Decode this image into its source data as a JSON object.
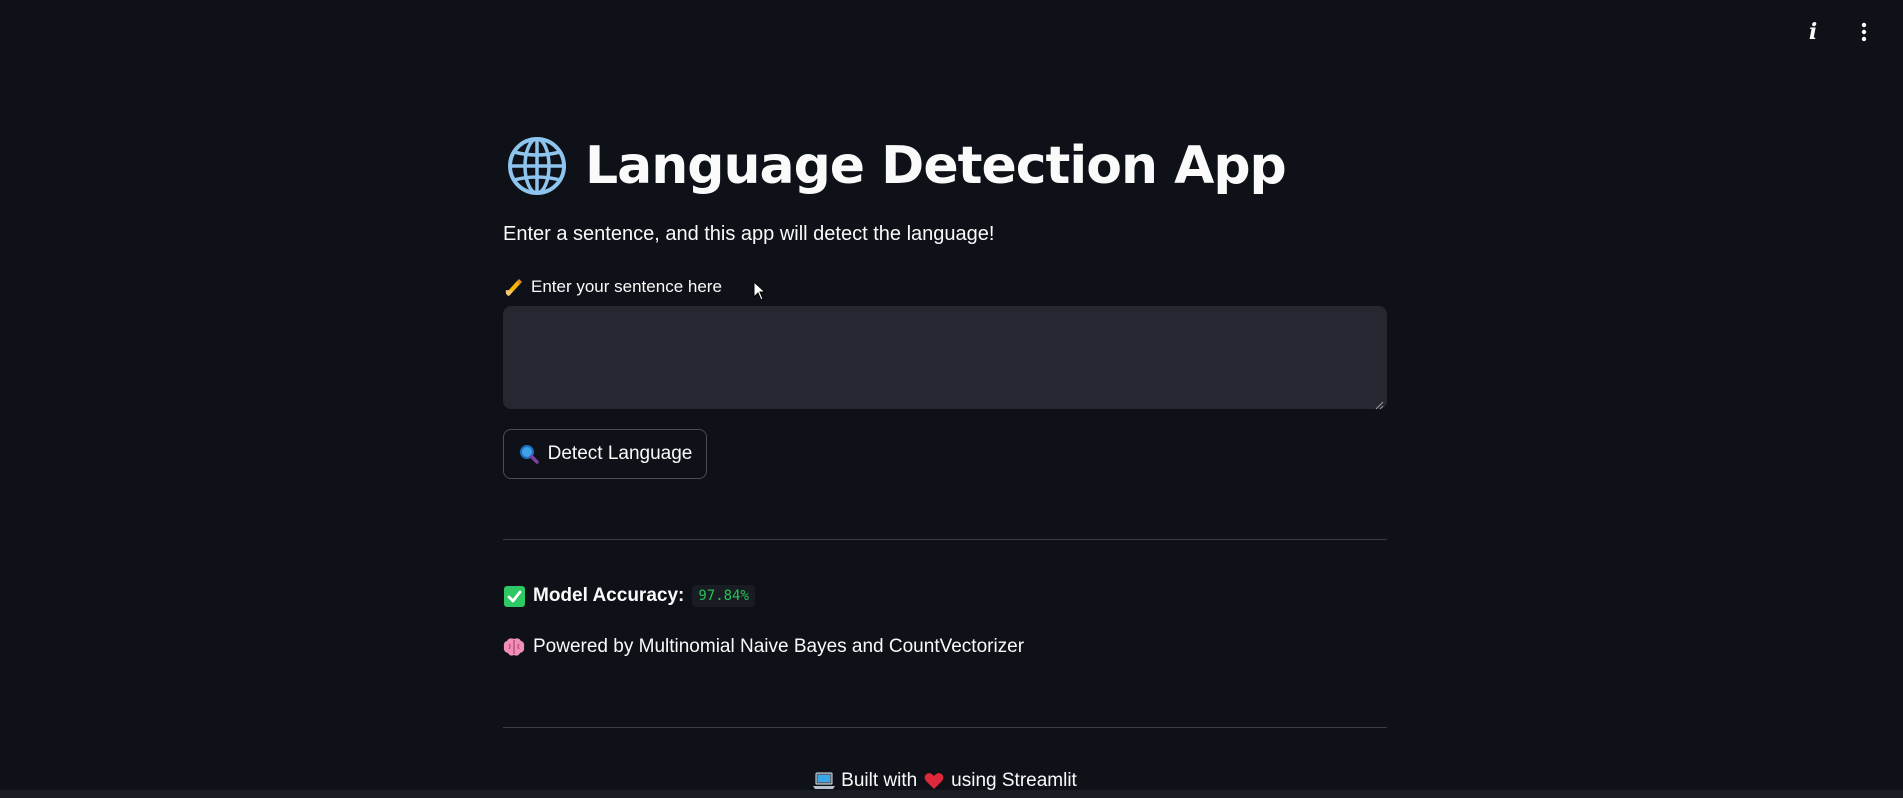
{
  "header": {
    "info_icon": "i",
    "menu_icon": "kebab-menu-icon"
  },
  "app": {
    "title": "Language Detection App",
    "title_icon": "globe-icon",
    "subtitle": "Enter a sentence, and this app will detect the language!",
    "input": {
      "label": "Enter your sentence here",
      "label_icon": "writing-hand-icon",
      "value": "",
      "placeholder": ""
    },
    "detect_button": {
      "label": "Detect Language",
      "icon": "magnifier-icon"
    },
    "accuracy": {
      "label": "Model Accuracy:",
      "value": "97.84%",
      "icon": "check-mark-icon"
    },
    "powered_by": {
      "text": "Powered by Multinomial Naive Bayes and CountVectorizer",
      "icon": "brain-icon"
    },
    "footer": {
      "text_before": "Built with",
      "text_after": "using Streamlit",
      "icon_laptop": "laptop-icon",
      "icon_heart": "heart-icon"
    }
  },
  "colors": {
    "background": "#0e1117",
    "text": "#fafafa",
    "input_bg": "#262730",
    "accent_green": "#21c354"
  }
}
